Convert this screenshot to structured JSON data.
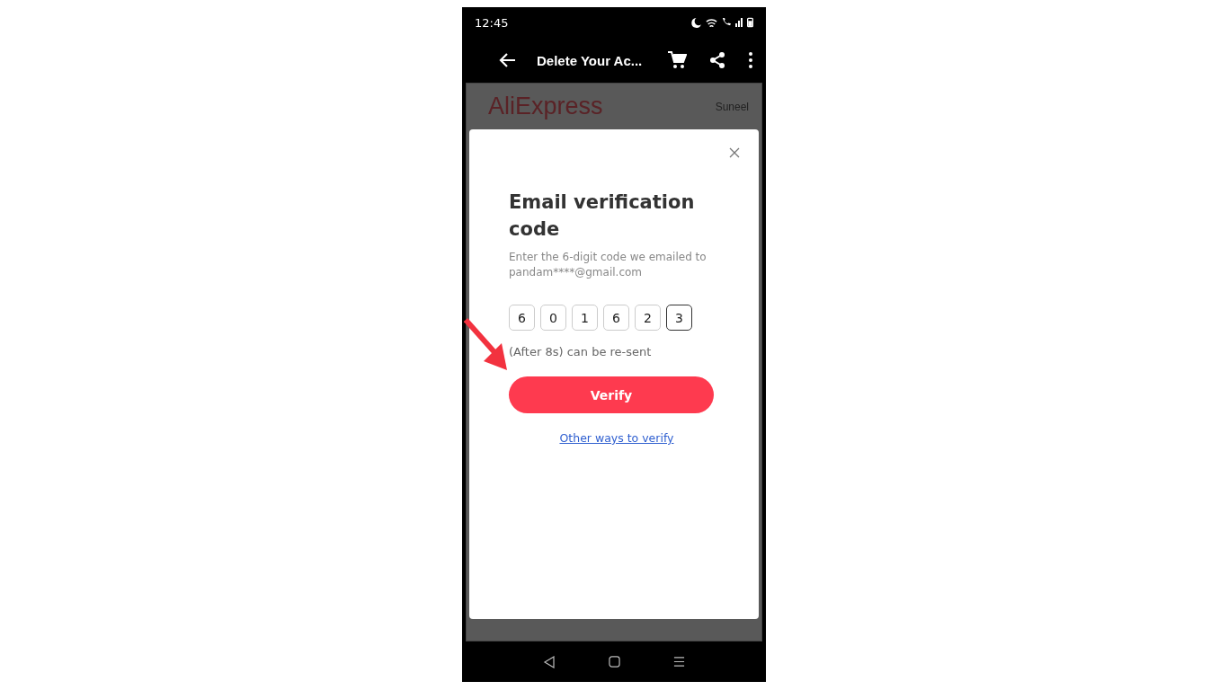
{
  "status_bar": {
    "time": "12:45"
  },
  "app_bar": {
    "title": "Delete Your Ac..."
  },
  "page": {
    "logo": "AliExpress",
    "user": "Suneel"
  },
  "dialog": {
    "title": "Email verification code",
    "subtitle": "Enter the 6-digit code we emailed to pandam****@gmail.com",
    "digits": [
      {
        "value": "6",
        "focused": false
      },
      {
        "value": "0",
        "focused": false
      },
      {
        "value": "1",
        "focused": false
      },
      {
        "value": "6",
        "focused": false
      },
      {
        "value": "2",
        "focused": false
      },
      {
        "value": "3",
        "focused": true
      }
    ],
    "resend": "(After 8s) can be re-sent",
    "verify_button": "Verify",
    "link": "Other ways to verify"
  }
}
